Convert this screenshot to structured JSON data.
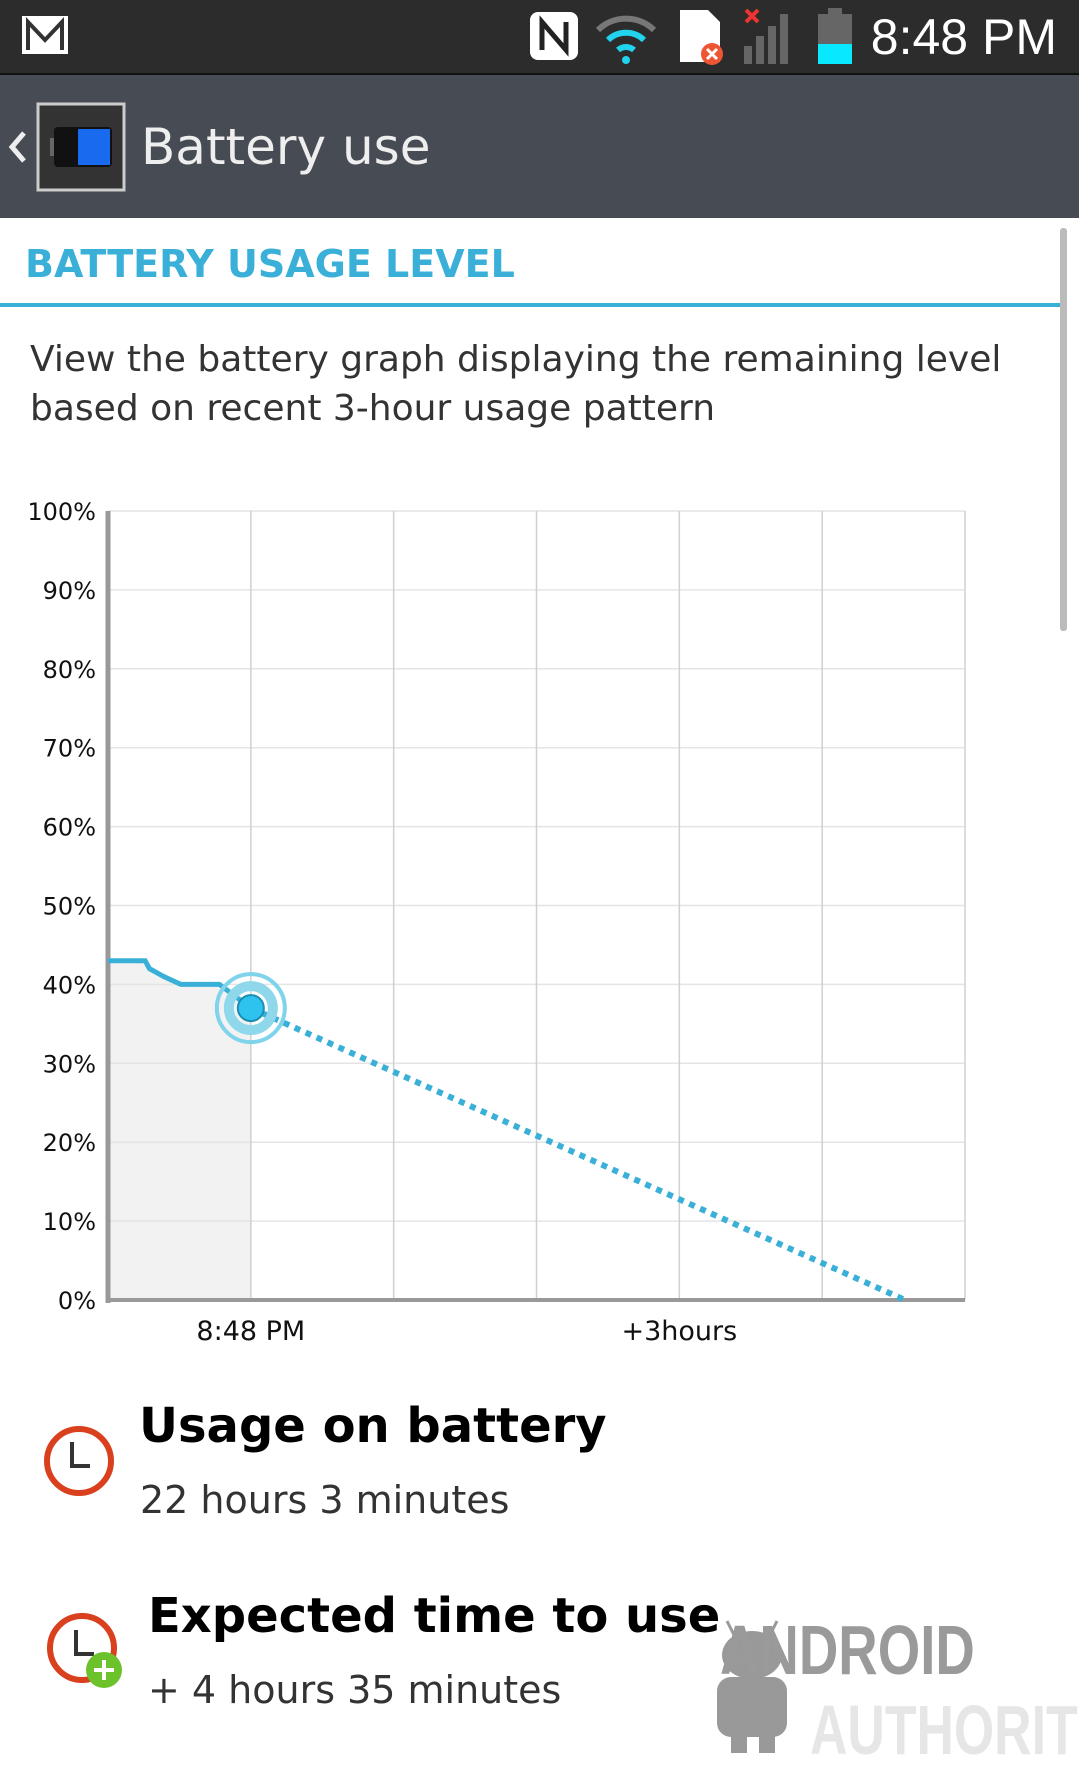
{
  "status_bar": {
    "time": "8:48 PM",
    "icons": [
      "gmail-icon",
      "nfc-icon",
      "wifi-icon",
      "sim-error-icon",
      "signal-no-service-icon",
      "battery-icon"
    ],
    "battery_level_percent": 37
  },
  "action_bar": {
    "title": "Battery use",
    "back_icon": "chevron-left-icon",
    "app_icon": "battery-app-icon"
  },
  "section": {
    "header": "BATTERY USAGE LEVEL",
    "description": "View the battery graph displaying the remaining level based on recent 3-hour usage pattern"
  },
  "colors": {
    "accent": "#3ab0d8",
    "action_bar": "#474b53",
    "status_bar": "#2c2c2c",
    "clock_ring": "#d9401e",
    "plus_badge": "#6cc22a"
  },
  "chart_data": {
    "type": "line",
    "y_ticks": [
      "100%",
      "90%",
      "80%",
      "70%",
      "60%",
      "50%",
      "40%",
      "30%",
      "20%",
      "10%",
      "0%"
    ],
    "x_tick_labels": [
      {
        "x": 0,
        "label": "8:48 PM"
      },
      {
        "x": 3,
        "label": "+3hours"
      }
    ],
    "xlim": [
      -1,
      5
    ],
    "ylim": [
      0,
      100
    ],
    "x_unit": "hours from now",
    "grid": true,
    "series": [
      {
        "style": "solid",
        "points": [
          [
            -1.0,
            43
          ],
          [
            -0.74,
            43
          ],
          [
            -0.71,
            42
          ],
          [
            -0.61,
            41
          ],
          [
            -0.49,
            40
          ],
          [
            -0.22,
            40
          ],
          [
            0,
            37
          ]
        ]
      },
      {
        "style": "dotted",
        "points": [
          [
            0,
            37
          ],
          [
            4.58,
            0
          ]
        ]
      }
    ],
    "current_point": [
      0,
      37
    ]
  },
  "stats": [
    {
      "title": "Usage on battery",
      "value": "22 hours 3 minutes",
      "icon": "clock-icon"
    },
    {
      "title": "Expected time to use",
      "value": "+ 4 hours 35 minutes",
      "icon": "clock-plus-icon"
    }
  ],
  "watermark": {
    "line1": "ANDROID",
    "line2": "AUTHORITY"
  }
}
